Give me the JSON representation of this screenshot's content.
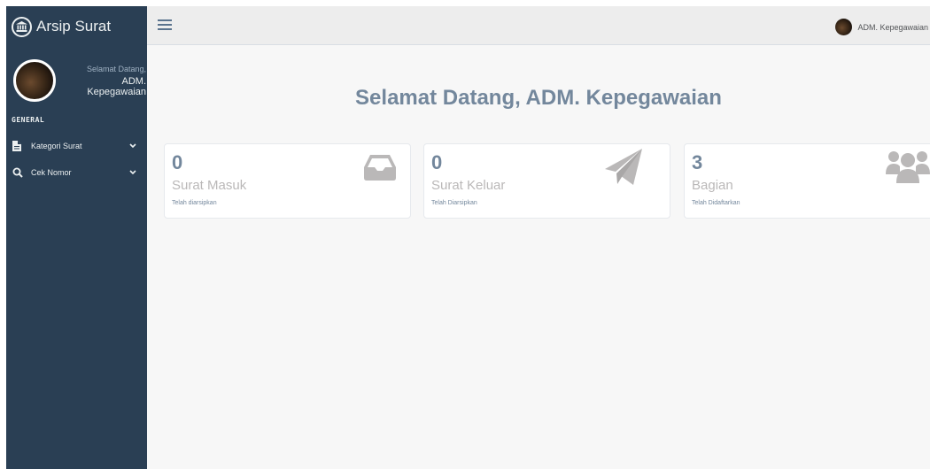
{
  "sidebar": {
    "brand": "Arsip Surat",
    "profile": {
      "welcome": "Selamat Datang,",
      "name": "ADM. Kepegawaian"
    },
    "section_title": "GENERAL",
    "menu": [
      {
        "label": "Kategori Surat",
        "icon": "file-icon"
      },
      {
        "label": "Cek Nomor",
        "icon": "search-icon"
      }
    ]
  },
  "topbar": {
    "user_name": "ADM. Kepegawaian"
  },
  "main": {
    "welcome": "Selamat Datang, ADM. Kepegawaian",
    "tiles": [
      {
        "count": "0",
        "label": "Surat Masuk",
        "sub": "Telah diarsipkan",
        "icon": "inbox-icon"
      },
      {
        "count": "0",
        "label": "Surat Keluar",
        "sub": "Telah Diarsipkan",
        "icon": "paper-plane-icon"
      },
      {
        "count": "3",
        "label": "Bagian",
        "sub": "Telah Didaftarkan",
        "icon": "users-icon"
      }
    ]
  },
  "colors": {
    "sidebar_bg": "#2a3f54",
    "content_bg": "#f7f7f7",
    "text_primary": "#73879c",
    "icon_gray": "#bab8b8"
  }
}
